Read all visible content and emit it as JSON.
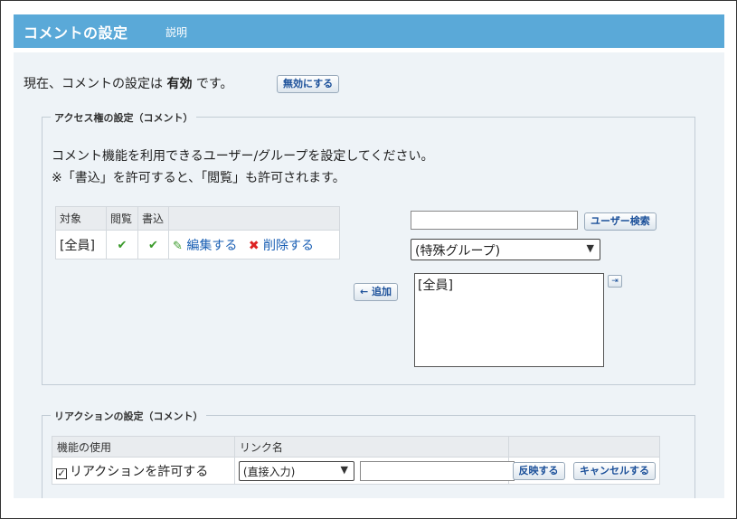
{
  "header": {
    "title": "コメントの設定",
    "help": "説明"
  },
  "status": {
    "prefix": "現在、コメントの設定は",
    "value": "有効",
    "suffix": "です。",
    "disable_button": "無効にする"
  },
  "access": {
    "legend": "アクセス権の設定（コメント）",
    "desc_line1": "コメント機能を利用できるユーザー/グループを設定してください。",
    "desc_line2": "※「書込」を許可すると、「閲覧」も許可されます。",
    "table": {
      "col_target": "対象",
      "col_view": "閲覧",
      "col_write": "書込",
      "rows": [
        {
          "target": "[全員]",
          "edit": "編集する",
          "delete": "削除する"
        }
      ]
    },
    "user_search_button": "ユーザー検索",
    "group_select": "(特殊グループ)",
    "add_button": "← 追加",
    "list_items": [
      "[全員]"
    ]
  },
  "reaction": {
    "legend": "リアクションの設定（コメント）",
    "col_usage": "機能の使用",
    "col_linkname": "リンク名",
    "allow_label": "リアクションを許可する",
    "allow_checked": true,
    "link_select": "(直接入力)",
    "apply_button": "反映する",
    "cancel_button": "キャンセルする"
  }
}
